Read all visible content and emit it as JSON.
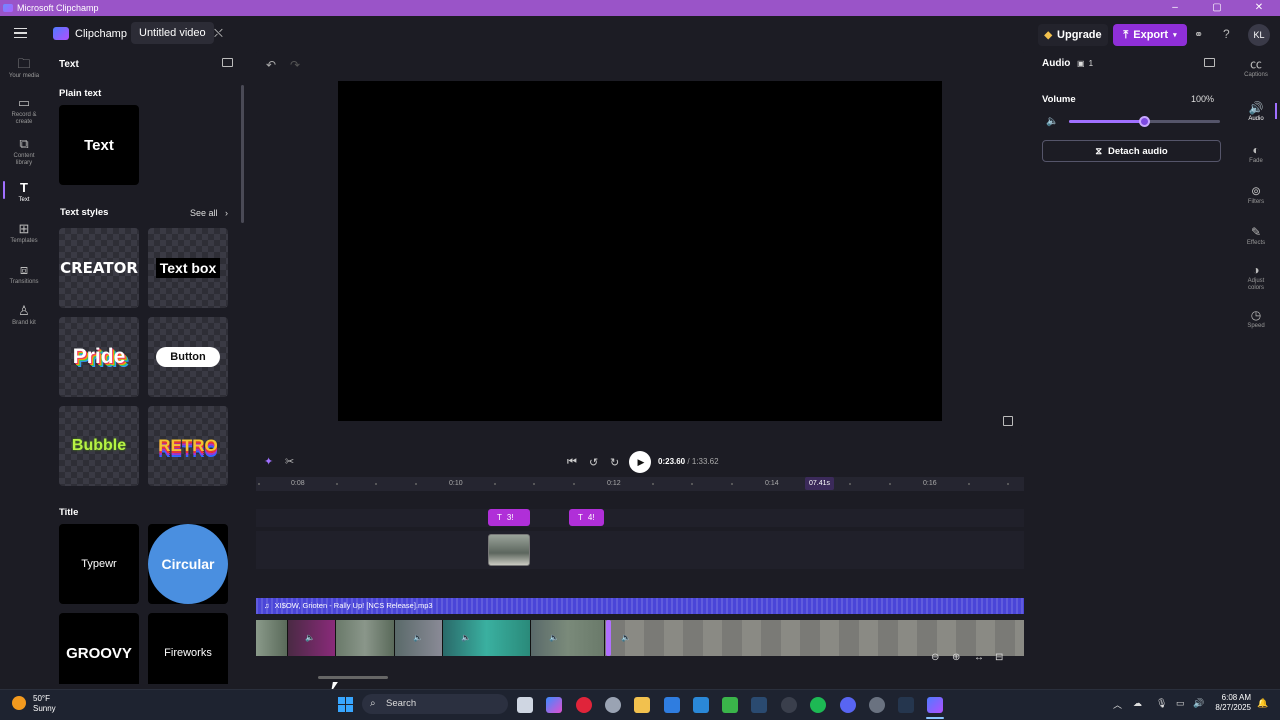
{
  "window": {
    "title": "Microsoft Clipchamp",
    "controls": [
      "–",
      "▢",
      "✕"
    ]
  },
  "appbar": {
    "brand": "Clipchamp",
    "project_name": "Untitled video",
    "upgrade_label": "Upgrade",
    "export_label": "Export",
    "avatar_initials": "KL"
  },
  "left_rail": [
    {
      "label": "Your media",
      "icon": "folder-icon"
    },
    {
      "label": "Record & create",
      "icon": "camera-icon"
    },
    {
      "label": "Content library",
      "icon": "library-icon"
    },
    {
      "label": "Text",
      "icon": "text-icon",
      "active": true
    },
    {
      "label": "Templates",
      "icon": "templates-icon"
    },
    {
      "label": "Transitions",
      "icon": "transitions-icon"
    },
    {
      "label": "Brand kit",
      "icon": "brand-kit-icon"
    }
  ],
  "text_panel": {
    "title": "Text",
    "plain_text_heading": "Plain text",
    "plain_text_tile": "Text",
    "styles_heading": "Text styles",
    "see_all": "See all",
    "styles": [
      "CREATOR",
      "Text box",
      "Pride",
      "Button",
      "Bubble",
      "RETRO"
    ],
    "title_heading": "Title",
    "titles": [
      "Typewr",
      "Circular",
      "GROOVY",
      "Fireworks"
    ]
  },
  "playback": {
    "current_time": "0:23.60",
    "total_time": "/ 1:33.62"
  },
  "ruler": {
    "ticks": [
      "0:08",
      "0:10",
      "0:12",
      "0:14",
      "0:16"
    ],
    "playhead_label": "07.41s"
  },
  "timeline": {
    "text_clips": [
      "3!",
      "4!"
    ],
    "audio_track_name": "XI$OW, Grioten - Rally Up! [NCS Release].mp3"
  },
  "properties": {
    "title": "Audio",
    "count": "1",
    "volume_heading": "Volume",
    "volume_value": "100%",
    "volume_level": 0.5,
    "detach_label": "Detach audio"
  },
  "right_rail": [
    {
      "label": "Captions",
      "icon": "captions-icon"
    },
    {
      "label": "Audio",
      "icon": "audio-icon",
      "active": true
    },
    {
      "label": "Fade",
      "icon": "fade-icon"
    },
    {
      "label": "Filters",
      "icon": "filters-icon"
    },
    {
      "label": "Effects",
      "icon": "effects-icon"
    },
    {
      "label": "Adjust colors",
      "icon": "adjust-colors-icon"
    },
    {
      "label": "Speed",
      "icon": "speed-icon"
    }
  ],
  "taskbar": {
    "temperature": "50°F",
    "condition": "Sunny",
    "search_placeholder": "Search",
    "time": "6:08 AM",
    "date": "8/27/2025"
  },
  "colors": {
    "accent": "#8f2fd8",
    "text_clip": "#b02fd8",
    "audio_track": "#4a45d8",
    "background": "#1c1c24"
  }
}
